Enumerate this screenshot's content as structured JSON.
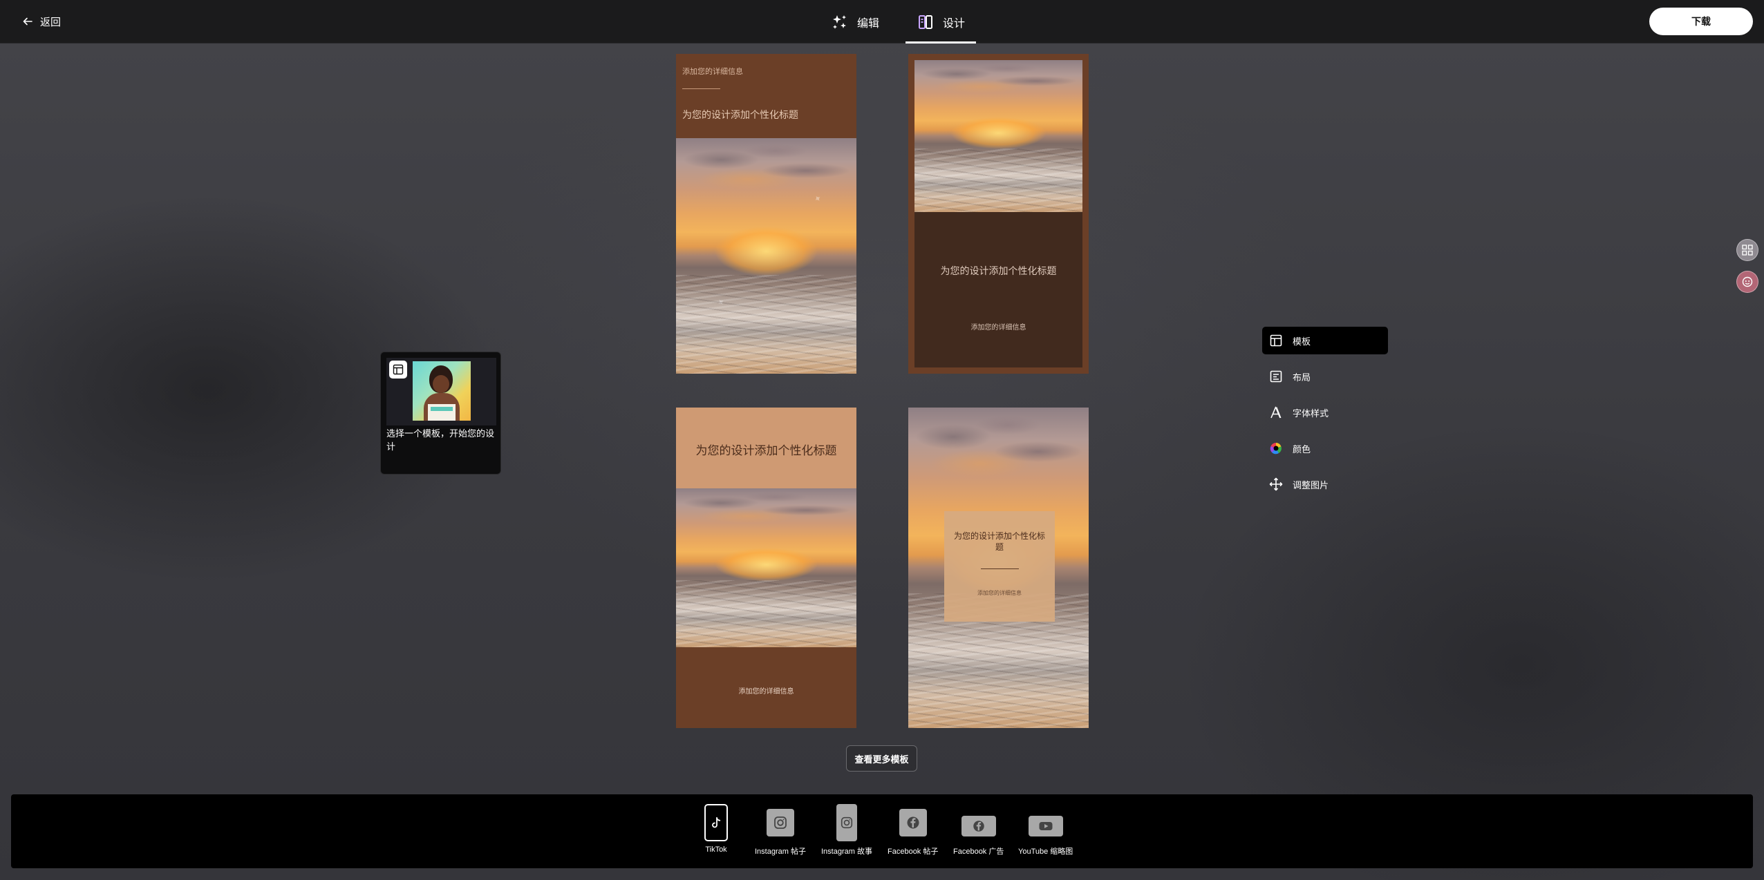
{
  "topbar": {
    "back_label": "返回",
    "tabs": [
      {
        "label": "编辑",
        "icon": "sparkles-icon"
      },
      {
        "label": "设计",
        "icon": "design-panels-icon"
      }
    ],
    "active_tab": "设计",
    "download_label": "下载"
  },
  "templates": [
    {
      "title": "为您的设计添加个性化标题",
      "subtitle": "添加您的详细信息",
      "bg": "#6b3f27"
    },
    {
      "title": "为您的设计添加个性化标题",
      "subtitle": "添加您的详细信息",
      "bg": "#412a1e"
    },
    {
      "title": "为您的设计添加个性化标题",
      "subtitle": "添加您的详细信息",
      "bg": "#cf9a73"
    },
    {
      "title": "为您的设计添加个性化标题",
      "subtitle": "添加您的详细信息",
      "bg": "#d6aa80"
    }
  ],
  "tooltip": {
    "text": "选择一个模板，开始您的设计"
  },
  "side_menu": [
    {
      "label": "模板",
      "icon": "template-icon",
      "active": true
    },
    {
      "label": "布局",
      "icon": "layout-icon",
      "active": false
    },
    {
      "label": "字体样式",
      "icon": "font-style-icon",
      "active": false
    },
    {
      "label": "颜色",
      "icon": "color-wheel-icon",
      "active": false
    },
    {
      "label": "调整图片",
      "icon": "move-arrows-icon",
      "active": false
    }
  ],
  "view_more_label": "查看更多模板",
  "platforms": [
    {
      "label": "TikTok",
      "icon": "tiktok-icon",
      "active": true
    },
    {
      "label": "Instagram 帖子",
      "icon": "instagram-icon",
      "active": false
    },
    {
      "label": "Instagram 故事",
      "icon": "instagram-icon",
      "active": false
    },
    {
      "label": "Facebook 帖子",
      "icon": "facebook-icon",
      "active": false
    },
    {
      "label": "Facebook 广告",
      "icon": "facebook-icon",
      "active": false
    },
    {
      "label": "YouTube 缩略图",
      "icon": "youtube-icon",
      "active": false
    }
  ]
}
